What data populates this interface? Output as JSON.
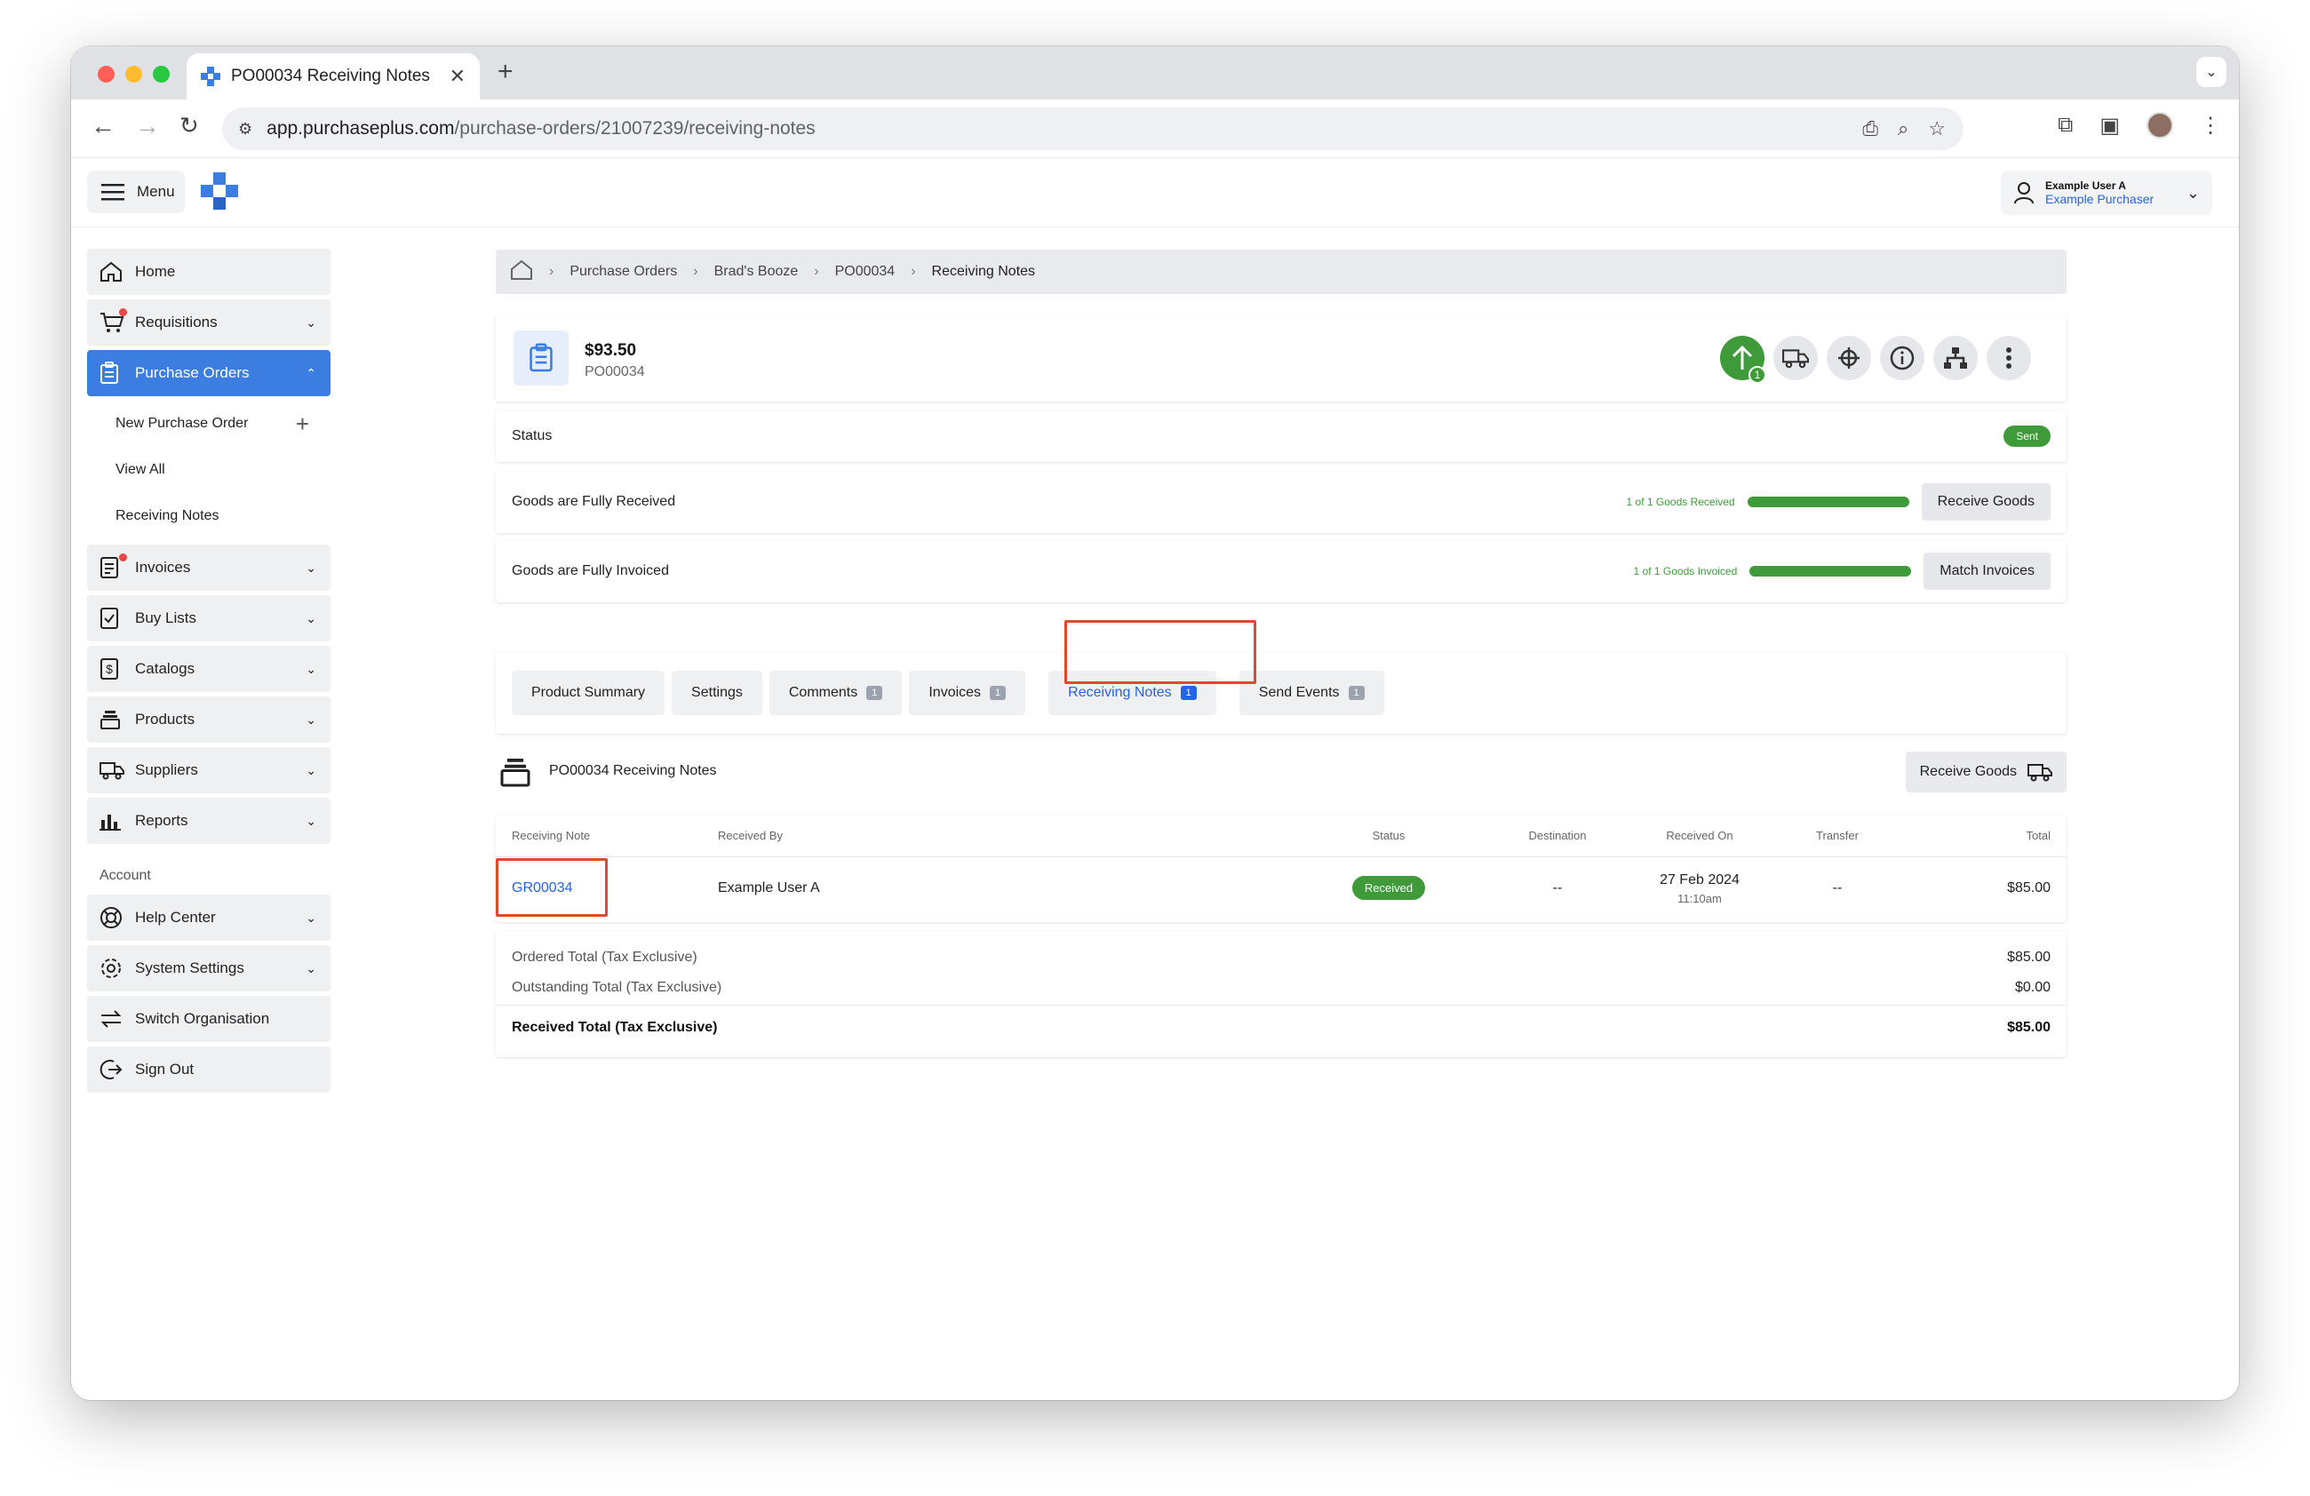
{
  "browser": {
    "tab_title": "PO00034 Receiving Notes",
    "url_domain": "app.purchaseplus.com",
    "url_path": "/purchase-orders/21007239/receiving-notes"
  },
  "header": {
    "menu_label": "Menu",
    "user_name": "Example User A",
    "user_role": "Example Purchaser"
  },
  "sidebar": {
    "items": [
      {
        "label": "Home"
      },
      {
        "label": "Requisitions"
      },
      {
        "label": "Purchase Orders"
      },
      {
        "label": "New Purchase Order"
      },
      {
        "label": "View All"
      },
      {
        "label": "Receiving Notes"
      },
      {
        "label": "Invoices"
      },
      {
        "label": "Buy Lists"
      },
      {
        "label": "Catalogs"
      },
      {
        "label": "Products"
      },
      {
        "label": "Suppliers"
      },
      {
        "label": "Reports"
      }
    ],
    "account_heading": "Account",
    "account_items": [
      {
        "label": "Help Center"
      },
      {
        "label": "System Settings"
      },
      {
        "label": "Switch Organisation"
      },
      {
        "label": "Sign Out"
      }
    ]
  },
  "breadcrumb": [
    "Purchase Orders",
    "Brad's Booze",
    "PO00034",
    "Receiving Notes"
  ],
  "po": {
    "amount": "$93.50",
    "number": "PO00034",
    "action_badge": "1"
  },
  "status_row": {
    "label": "Status",
    "value": "Sent"
  },
  "received_row": {
    "label": "Goods are Fully Received",
    "progress_text": "1 of 1 Goods Received",
    "progress": 1.0,
    "button": "Receive Goods"
  },
  "invoiced_row": {
    "label": "Goods are Fully Invoiced",
    "progress_text": "1 of 1 Goods Invoiced",
    "progress": 1.0,
    "button": "Match Invoices"
  },
  "tabs": [
    {
      "label": "Product Summary",
      "count": ""
    },
    {
      "label": "Settings",
      "count": ""
    },
    {
      "label": "Comments",
      "count": "1"
    },
    {
      "label": "Invoices",
      "count": "1"
    },
    {
      "label": "Receiving Notes",
      "count": "1"
    },
    {
      "label": "Send Events",
      "count": "1"
    }
  ],
  "receiving_notes": {
    "title": "PO00034 Receiving Notes",
    "button": "Receive Goods",
    "columns": [
      "Receiving Note",
      "Received By",
      "Status",
      "Destination",
      "Received On",
      "Transfer",
      "Total"
    ],
    "rows": [
      {
        "note": "GR00034",
        "received_by": "Example User A",
        "status": "Received",
        "destination": "--",
        "date": "27 Feb 2024",
        "time": "11:10am",
        "transfer": "--",
        "total": "$85.00"
      }
    ]
  },
  "totals": {
    "ordered_label": "Ordered Total (Tax Exclusive)",
    "ordered_value": "$85.00",
    "outstanding_label": "Outstanding Total (Tax Exclusive)",
    "outstanding_value": "$0.00",
    "received_label": "Received Total (Tax Exclusive)",
    "received_value": "$85.00"
  },
  "colors": {
    "primary": "#3b7de0",
    "success": "#3f9a3a",
    "highlight": "#e2482d"
  }
}
